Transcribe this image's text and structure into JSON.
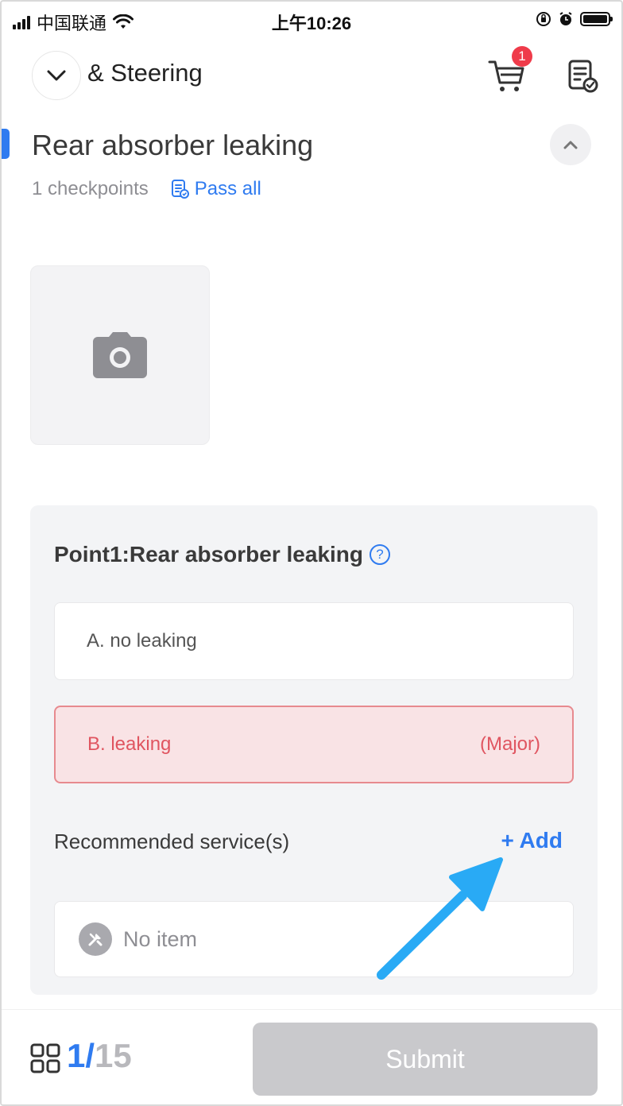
{
  "status_bar": {
    "carrier": "中国联通",
    "time": "上午10:26"
  },
  "header": {
    "title": "& Steering",
    "cart_badge": "1"
  },
  "section": {
    "title": "Rear absorber leaking",
    "checkpoints": "1 checkpoints",
    "pass_all": "Pass all"
  },
  "point": {
    "title": "Point1:Rear absorber leaking",
    "options": [
      {
        "label": "A. no leaking",
        "tag": ""
      },
      {
        "label": "B. leaking",
        "tag": "(Major)"
      }
    ],
    "recommended_label": "Recommended service(s)",
    "add_label": "+ Add",
    "no_item_label": "No item"
  },
  "footer": {
    "current_page": "1/",
    "total_pages": "15",
    "submit_label": "Submit"
  },
  "colors": {
    "accent": "#2f7bf0",
    "danger": "#e05560",
    "danger_bg": "#f9e3e5",
    "badge": "#ef3b4a",
    "annotation_arrow": "#29aaf5"
  }
}
